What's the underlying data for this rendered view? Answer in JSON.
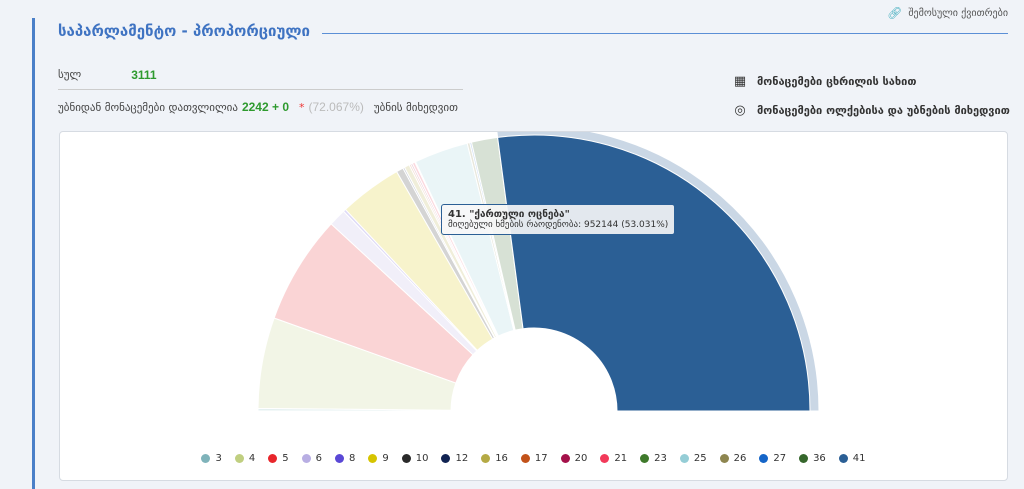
{
  "header": {
    "title": "საპარლამენტო - პროპორციული",
    "link": "შემოსული ქვითრები"
  },
  "stats": {
    "total_label": "სულ",
    "total_value": "3111",
    "counted_label": "უბნიდან მონაცემები დათვლილია",
    "counted_value": "2242 + 0",
    "star": "*",
    "counted_pct": "(72.067%)",
    "suffix": "უბნის მიხედვით"
  },
  "links": [
    {
      "icon": "table-icon",
      "label": "მონაცემები ცხრილის სახით"
    },
    {
      "icon": "location-person-icon",
      "label": "მონაცემები ოლქებისა და უბნების მიხედვით"
    }
  ],
  "tooltip": {
    "title": "41. \"ქართული ოცნება\"",
    "label": "მიღებული ხმების რაოდენობა:",
    "value": "952144 (53.031%)"
  },
  "chart_data": {
    "type": "pie",
    "subtype": "semi-donut",
    "hovered": "41",
    "series": [
      {
        "name": "3",
        "value": 0.3,
        "color": "#7fb3ba"
      },
      {
        "name": "4",
        "value": 10.4,
        "color": "#c0cf80"
      },
      {
        "name": "5",
        "value": 12.5,
        "color": "#e8262b"
      },
      {
        "name": "6",
        "value": 2.0,
        "color": "#b8aee3"
      },
      {
        "name": "8",
        "value": 0.3,
        "color": "#5a48d6"
      },
      {
        "name": "9",
        "value": 7.2,
        "color": "#d6c400"
      },
      {
        "name": "10",
        "value": 0.8,
        "color": "#2a2a2a"
      },
      {
        "name": "12",
        "value": 0.2,
        "color": "#112352"
      },
      {
        "name": "16",
        "value": 0.6,
        "color": "#b5aa45"
      },
      {
        "name": "17",
        "value": 0.2,
        "color": "#c2521a"
      },
      {
        "name": "20",
        "value": 0.2,
        "color": "#a4114a"
      },
      {
        "name": "21",
        "value": 0.3,
        "color": "#f23a5a"
      },
      {
        "name": "23",
        "value": 0.1,
        "color": "#3f7a2b"
      },
      {
        "name": "25",
        "value": 6.2,
        "color": "#95cdd6"
      },
      {
        "name": "26",
        "value": 0.3,
        "color": "#8e8650"
      },
      {
        "name": "27",
        "value": 0.2,
        "color": "#1565c8"
      },
      {
        "name": "36",
        "value": 3.0,
        "color": "#36672c"
      },
      {
        "name": "41",
        "value": 53.031,
        "color": "#2b5f95"
      }
    ]
  }
}
